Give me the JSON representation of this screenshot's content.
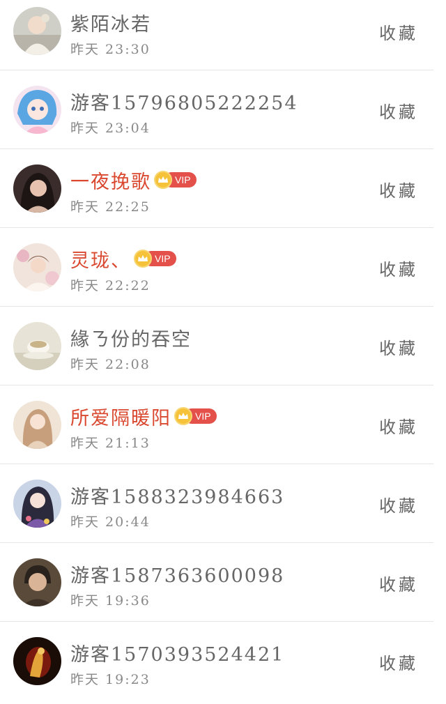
{
  "favorite_label": "收藏",
  "vip_label": "VIP",
  "items": [
    {
      "name": "紫陌冰若",
      "time": "昨天 23:30",
      "vip": false,
      "avatar": "child-photo-avatar"
    },
    {
      "name": "游客15796805222254",
      "time": "昨天 23:04",
      "vip": false,
      "avatar": "anime-girl-avatar"
    },
    {
      "name": "一夜挽歌",
      "time": "昨天 22:25",
      "vip": true,
      "avatar": "woman-dark-hair-avatar"
    },
    {
      "name": "灵珑、",
      "time": "昨天 22:22",
      "vip": true,
      "avatar": "woman-flowers-avatar"
    },
    {
      "name": "緣ㄋ份的吞空",
      "time": "昨天 22:08",
      "vip": false,
      "avatar": "teacup-avatar"
    },
    {
      "name": "所爱隔暖阳",
      "time": "昨天 21:13",
      "vip": true,
      "avatar": "anime-beige-avatar"
    },
    {
      "name": "游客15883239846​63",
      "time": "昨天 20:44",
      "vip": false,
      "avatar": "anime-kimono-avatar"
    },
    {
      "name": "游客1587363600098",
      "time": "昨天 19:36",
      "vip": false,
      "avatar": "man-portrait-avatar"
    },
    {
      "name": "游客1570393524421",
      "time": "昨天 19:23",
      "vip": false,
      "avatar": "golden-figure-avatar"
    }
  ]
}
